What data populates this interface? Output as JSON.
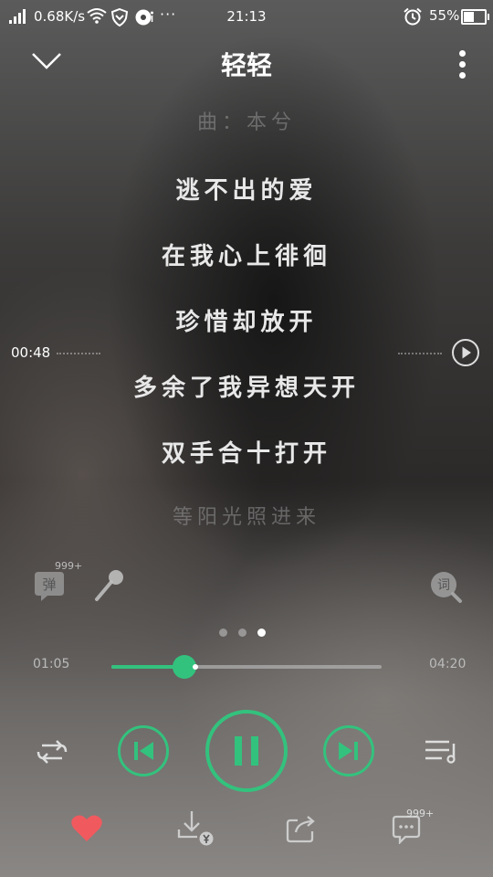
{
  "status_bar": {
    "network_speed": "0.68K/s",
    "time": "21:13",
    "overflow": "···",
    "battery_percent": "55%",
    "battery_level": 0.55
  },
  "header": {
    "title": "轻轻",
    "collapse_icon": "chevron-down-icon",
    "more_icon": "more-vertical-icon"
  },
  "lyrics": {
    "lines": [
      {
        "text": "曲：本兮",
        "state": "faded"
      },
      {
        "text": "逃不出的爱",
        "state": "normal"
      },
      {
        "text": "在我心上徘徊",
        "state": "normal"
      },
      {
        "text": "珍惜却放开",
        "state": "normal"
      },
      {
        "text": "多余了我异想天开",
        "state": "normal"
      },
      {
        "text": "双手合十打开",
        "state": "normal"
      },
      {
        "text": "等阳光照进来",
        "state": "faded"
      }
    ],
    "scrub_time": "00:48"
  },
  "tools": {
    "danmu_label": "弹",
    "danmu_count": "999+",
    "lyric_label": "词"
  },
  "pager": {
    "count": 3,
    "active": 2
  },
  "progress": {
    "current": "01:05",
    "total": "04:20",
    "fraction": 0.27
  },
  "controls": {
    "loop_icon": "repeat-icon",
    "prev_icon": "previous-icon",
    "pause_icon": "pause-icon",
    "next_icon": "next-icon",
    "playlist_icon": "playlist-icon"
  },
  "bottom": {
    "comment_count": "999+",
    "icons": [
      "heart-icon",
      "download-icon",
      "share-icon",
      "comment-icon"
    ]
  },
  "colors": {
    "accent": "#33c27d",
    "heart": "#f05a5e"
  }
}
